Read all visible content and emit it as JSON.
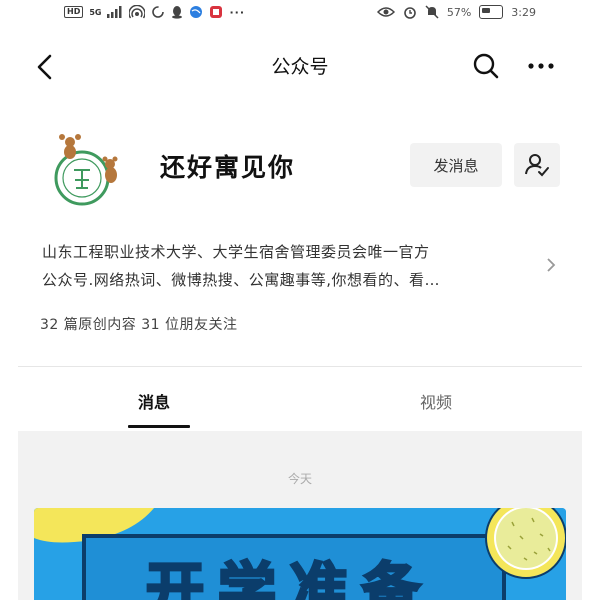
{
  "status_bar": {
    "network_hd": "HD",
    "network_gen": "5G",
    "battery_percent": "57%",
    "time": "3:29"
  },
  "nav": {
    "title": "公众号"
  },
  "profile": {
    "name": "还好寓见你",
    "message_button": "发消息",
    "description_line1": "山东工程职业技术大学、大学生宿舍管理委员会唯一官方",
    "description_line2": "公众号.网络热词、微博热搜、公寓趣事等,你想看的、看…",
    "stats": "32 篇原创内容  31 位朋友关注"
  },
  "tabs": [
    {
      "label": "消息",
      "active": true
    },
    {
      "label": "视频",
      "active": false
    }
  ],
  "feed": {
    "date_label": "今天",
    "banner_text": "开学准备"
  },
  "colors": {
    "accent": "#111111",
    "banner_blue": "#27a1e6",
    "banner_yellow": "#f4e65a",
    "avatar_green": "#3f9a5e"
  },
  "icons": {
    "back": "back-arrow-icon",
    "search": "search-icon",
    "more": "more-icon",
    "follow": "person-check-icon",
    "chevron": "chevron-right-icon"
  }
}
